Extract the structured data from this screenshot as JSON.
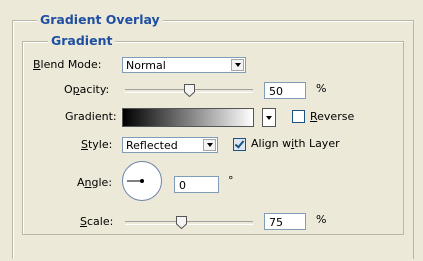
{
  "section": {
    "title": "Gradient Overlay"
  },
  "group": {
    "title": "Gradient"
  },
  "blend_mode": {
    "label": "Blend Mode:",
    "value": "Normal"
  },
  "opacity": {
    "label": "Opacity:",
    "value": "50",
    "unit": "%",
    "slider_value": 50
  },
  "gradient": {
    "label": "Gradient:",
    "reverse_label": "Reverse",
    "reverse_checked": false
  },
  "style": {
    "label": "Style:",
    "value": "Reflected",
    "align_label": "Align with Layer",
    "align_checked": true
  },
  "angle": {
    "label": "Angle:",
    "value": "0",
    "unit": "°"
  },
  "scale": {
    "label": "Scale:",
    "value": "75",
    "unit": "%",
    "slider_value": 75
  }
}
